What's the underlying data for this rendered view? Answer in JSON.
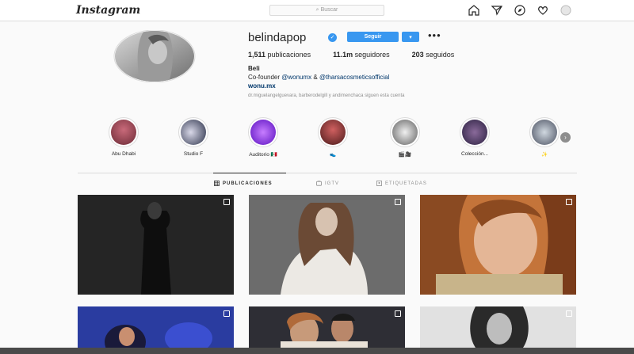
{
  "header": {
    "logo": "Instagram",
    "search_placeholder": "Buscar",
    "icons": [
      "home-icon",
      "direct-icon",
      "explore-icon",
      "heart-icon",
      "profile-icon"
    ]
  },
  "profile": {
    "username": "belindapop",
    "verified": true,
    "follow_label": "Seguir",
    "dropdown_label": "▾",
    "more_label": "•••",
    "stats": {
      "posts_value": "1,511",
      "posts_label": "publicaciones",
      "followers_value": "11.1m",
      "followers_label": "seguidores",
      "following_value": "203",
      "following_label": "seguidos"
    },
    "full_name": "Beli",
    "bio_prefix": "Co-founder ",
    "bio_mention1": "@wonumx",
    "bio_sep": " & ",
    "bio_mention2": "@tharsacosmeticsofficial",
    "website": "wonu.mx",
    "followed_by": "dr.miguelangelguevara, barberodelgill y andimenchaca siguen esta cuenta"
  },
  "highlights": [
    {
      "label": "Abu Dhabi"
    },
    {
      "label": "Studio F"
    },
    {
      "label": "Auditorio 🇲🇽"
    },
    {
      "label": "👟"
    },
    {
      "label": "🎬🎥"
    },
    {
      "label": "Colección..."
    },
    {
      "label": "✨"
    }
  ],
  "tabs": [
    {
      "label": "PUBLICACIONES",
      "icon": "grid-icon",
      "active": true
    },
    {
      "label": "IGTV",
      "icon": "igtv-icon",
      "active": false
    },
    {
      "label": "ETIQUETADAS",
      "icon": "tag-icon",
      "active": false
    }
  ],
  "colors": {
    "accent": "#3897f0",
    "link": "#00376b",
    "border": "#dbdbdb",
    "background": "#fafafa"
  }
}
